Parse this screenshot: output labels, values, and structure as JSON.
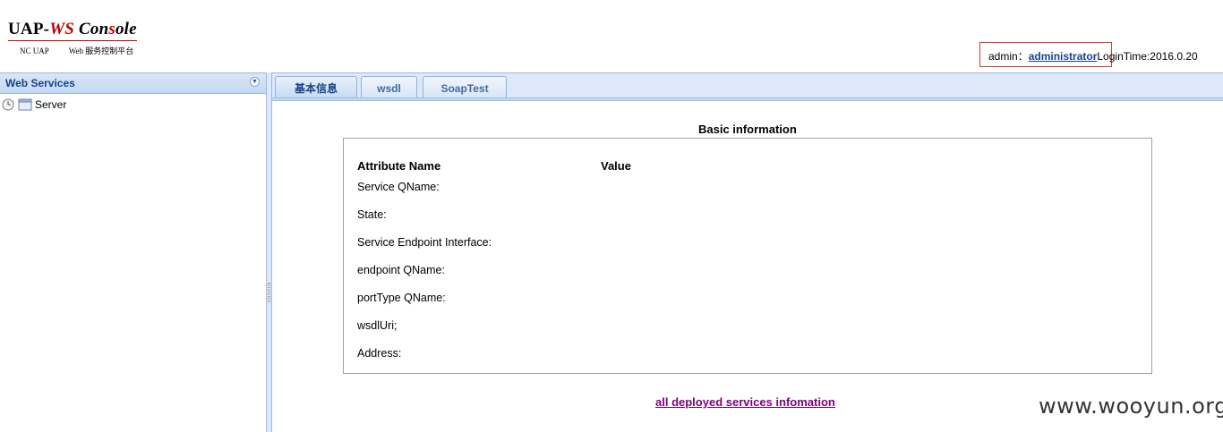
{
  "header": {
    "logo_part1": "UAP-",
    "logo_part2": "WS",
    "logo_part3": " Con",
    "logo_part4": "s",
    "logo_part5": "ole",
    "logo_sub_left": "NC UAP",
    "logo_sub_right": "Web 服务控制平台",
    "user_prefix": "admin：",
    "user_link": "administrator",
    "login_time": "LoginTime:2016.0.20"
  },
  "sidebar": {
    "title": "Web Services",
    "tree": [
      {
        "label": "Server"
      }
    ]
  },
  "tabs": [
    {
      "label": "基本信息",
      "active": true
    },
    {
      "label": "wsdl",
      "active": false
    },
    {
      "label": "SoapTest",
      "active": false
    }
  ],
  "main": {
    "section_title": "Basic information",
    "col_attr": "Attribute Name",
    "col_value": "Value",
    "attributes": [
      "Service QName:",
      "State:",
      "Service Endpoint Interface:",
      "endpoint QName:",
      "portType QName:",
      "wsdlUri;",
      "Address:"
    ],
    "footer_link": "all deployed services infomation"
  },
  "watermark": "www.wooyun.org",
  "colors": {
    "accent_blue": "#15428b",
    "panel_border": "#99bbe8",
    "highlight_red": "#d43a3a",
    "visited_link": "#800080"
  }
}
